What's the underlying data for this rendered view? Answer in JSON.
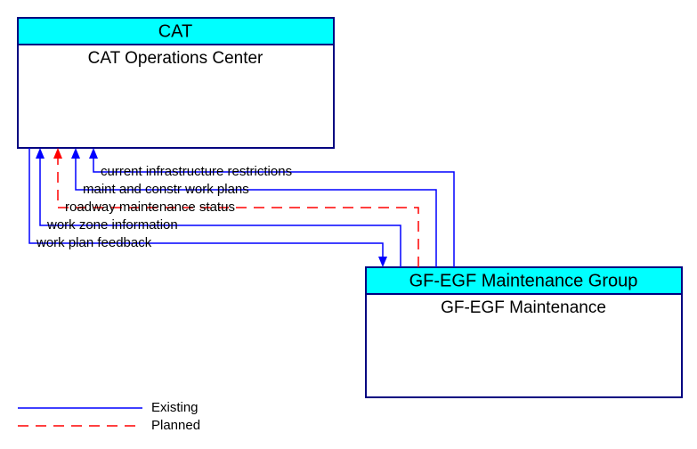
{
  "boxes": {
    "cat": {
      "header": "CAT",
      "body": "CAT Operations Center"
    },
    "gf": {
      "header": "GF-EGF Maintenance Group",
      "body": "GF-EGF Maintenance"
    }
  },
  "flows": {
    "f1": {
      "label": "current infrastructure restrictions",
      "type": "existing",
      "direction": "gf_to_cat"
    },
    "f2": {
      "label": "maint and constr work plans",
      "type": "existing",
      "direction": "gf_to_cat"
    },
    "f3": {
      "label": "roadway maintenance status",
      "type": "planned",
      "direction": "gf_to_cat"
    },
    "f4": {
      "label": "work zone information",
      "type": "existing",
      "direction": "gf_to_cat"
    },
    "f5": {
      "label": "work plan feedback",
      "type": "existing",
      "direction": "cat_to_gf"
    }
  },
  "legend": {
    "existing": "Existing",
    "planned": "Planned"
  },
  "colors": {
    "existing": "#0000ff",
    "planned": "#ff0000",
    "header_fill": "#00ffff",
    "border": "#000080"
  }
}
